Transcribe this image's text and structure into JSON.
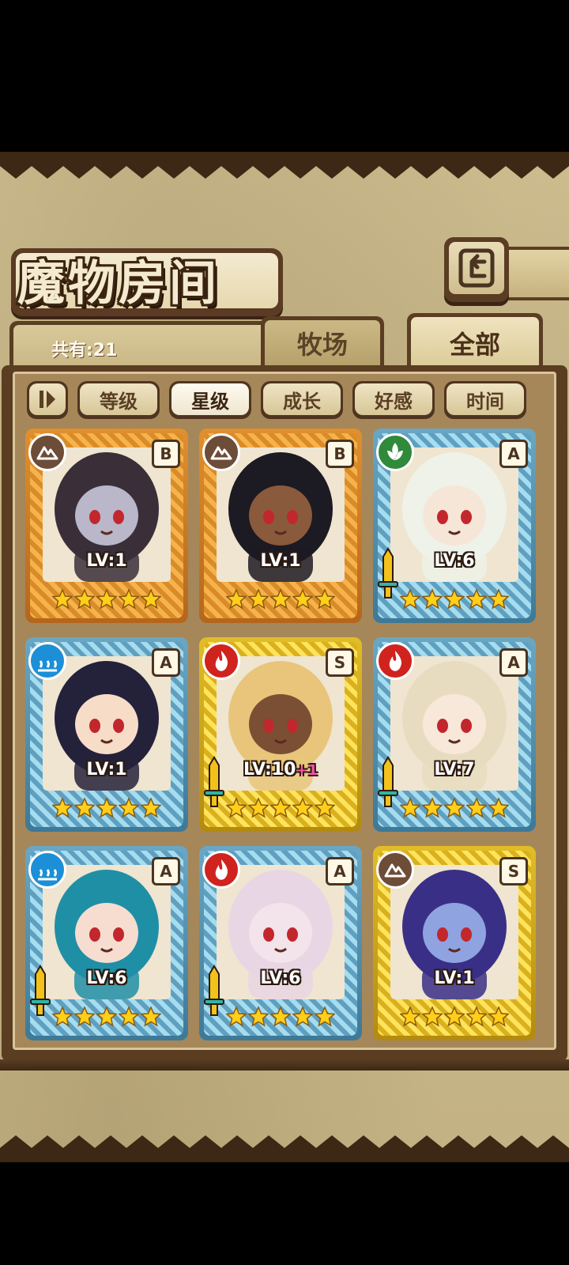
{
  "header": {
    "title": "魔物房间",
    "count": "共有:21"
  },
  "tabs": [
    {
      "label": "牧场",
      "active": false
    },
    {
      "label": "全部",
      "active": true
    }
  ],
  "sort_buttons": [
    {
      "label": "等级",
      "active": false
    },
    {
      "label": "星级",
      "active": true
    },
    {
      "label": "成长",
      "active": false
    },
    {
      "label": "好感",
      "active": false
    },
    {
      "label": "时间",
      "active": false
    }
  ],
  "colors": {
    "panel": "#c9b98a",
    "frame_dark": "#5b3d22",
    "star_fill": "#ffcf1a",
    "plus": "#ff4fb0"
  },
  "cards": [
    {
      "rank": "B",
      "element": "earth",
      "frame": "orange",
      "level": "LV:1",
      "bonus": "",
      "stars": 5,
      "sword": false,
      "hair": "#3a2f38",
      "skin": "#b9b7c9"
    },
    {
      "rank": "B",
      "element": "earth",
      "frame": "orange",
      "level": "LV:1",
      "bonus": "",
      "stars": 5,
      "sword": false,
      "hair": "#1c1a22",
      "skin": "#8a5a3c"
    },
    {
      "rank": "A",
      "element": "wind",
      "frame": "blue",
      "level": "LV:6",
      "bonus": "",
      "stars": 5,
      "sword": true,
      "hair": "#eef2e8",
      "skin": "#f6e6d8"
    },
    {
      "rank": "A",
      "element": "water",
      "frame": "blue",
      "level": "LV:1",
      "bonus": "",
      "stars": 5,
      "sword": false,
      "hair": "#24213a",
      "skin": "#f7dcc8"
    },
    {
      "rank": "S",
      "element": "fire",
      "frame": "gold",
      "level": "LV:10",
      "bonus": "+1",
      "stars": 5,
      "sword": true,
      "hair": "#e8c57a",
      "skin": "#7a4f34"
    },
    {
      "rank": "A",
      "element": "fire",
      "frame": "blue",
      "level": "LV:7",
      "bonus": "",
      "stars": 5,
      "sword": true,
      "hair": "#e8dcc0",
      "skin": "#f8e8da"
    },
    {
      "rank": "A",
      "element": "water",
      "frame": "blue",
      "level": "LV:6",
      "bonus": "",
      "stars": 5,
      "sword": true,
      "hair": "#1f8fa6",
      "skin": "#f6ddd0"
    },
    {
      "rank": "A",
      "element": "fire",
      "frame": "blue",
      "level": "LV:6",
      "bonus": "",
      "stars": 5,
      "sword": true,
      "hair": "#e9d6e4",
      "skin": "#f3e3ea"
    },
    {
      "rank": "S",
      "element": "earth",
      "frame": "gold",
      "level": "LV:1",
      "bonus": "",
      "stars": 5,
      "sword": false,
      "hair": "#3a2f86",
      "skin": "#8fa3e0"
    }
  ]
}
